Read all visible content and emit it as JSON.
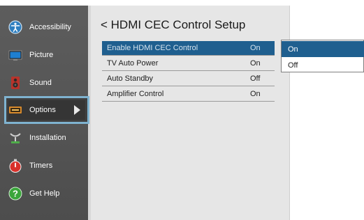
{
  "sidebar": {
    "items": [
      {
        "label": "Accessibility",
        "icon": "accessibility-icon"
      },
      {
        "label": "Picture",
        "icon": "picture-icon"
      },
      {
        "label": "Sound",
        "icon": "speaker-icon"
      },
      {
        "label": "Options",
        "icon": "options-icon",
        "selected": true
      },
      {
        "label": "Installation",
        "icon": "installation-icon"
      },
      {
        "label": "Timers",
        "icon": "timer-icon"
      },
      {
        "label": "Get Help",
        "icon": "help-icon"
      }
    ]
  },
  "main": {
    "title": "< HDMI CEC Control Setup",
    "rows": [
      {
        "label": "Enable HDMI CEC Control",
        "value": "On",
        "highlighted": true
      },
      {
        "label": "TV Auto Power",
        "value": "On"
      },
      {
        "label": "Auto Standby",
        "value": "Off"
      },
      {
        "label": "Amplifier Control",
        "value": "On"
      }
    ]
  },
  "dropdown": {
    "options": [
      {
        "label": "On",
        "selected": true
      },
      {
        "label": "Off"
      }
    ]
  },
  "colors": {
    "sidebar_bg": "#555555",
    "selection_border": "#7fb3d0",
    "highlight": "#1f5f8f",
    "main_bg": "#e6e6e6"
  }
}
